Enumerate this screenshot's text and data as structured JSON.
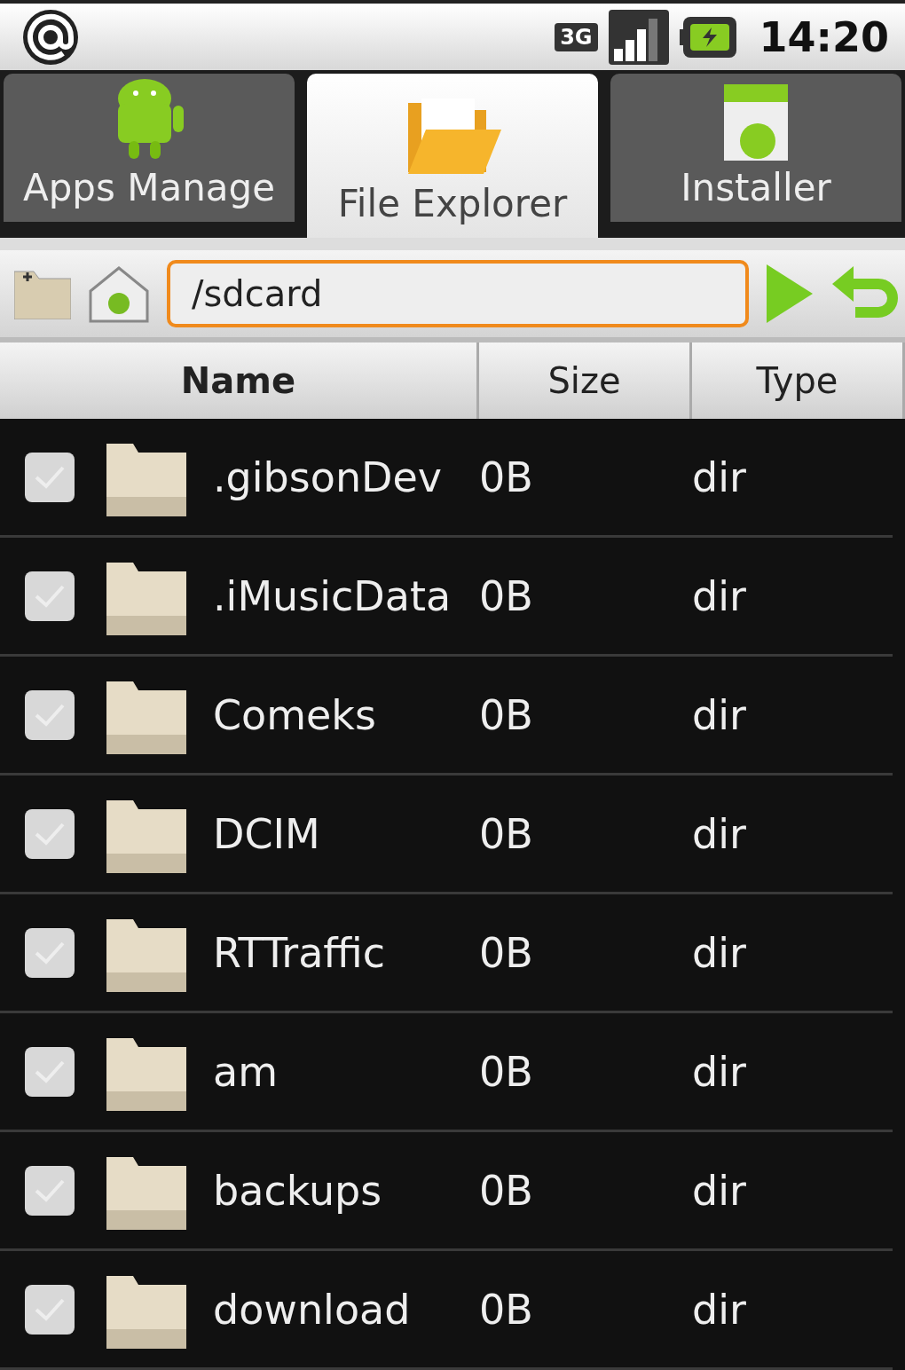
{
  "status_bar": {
    "time": "14:20",
    "network": "3G"
  },
  "tabs": [
    {
      "label": "Apps Manage",
      "selected": false,
      "kind": "robot"
    },
    {
      "label": "File Explorer",
      "selected": true,
      "kind": "folder"
    },
    {
      "label": "Installer",
      "selected": false,
      "kind": "package"
    }
  ],
  "path_field": {
    "value": "/sdcard"
  },
  "table": {
    "columns": [
      "Name",
      "Size",
      "Type"
    ],
    "rows": [
      {
        "name": ".gibsonDev",
        "size": "0B",
        "type": "dir",
        "checked": false
      },
      {
        "name": ".iMusicData",
        "size": "0B",
        "type": "dir",
        "checked": false
      },
      {
        "name": "Comeks",
        "size": "0B",
        "type": "dir",
        "checked": false
      },
      {
        "name": "DCIM",
        "size": "0B",
        "type": "dir",
        "checked": false
      },
      {
        "name": "RTTraffic",
        "size": "0B",
        "type": "dir",
        "checked": false
      },
      {
        "name": "am",
        "size": "0B",
        "type": "dir",
        "checked": false
      },
      {
        "name": "backups",
        "size": "0B",
        "type": "dir",
        "checked": false
      },
      {
        "name": "download",
        "size": "0B",
        "type": "dir",
        "checked": false
      }
    ]
  }
}
